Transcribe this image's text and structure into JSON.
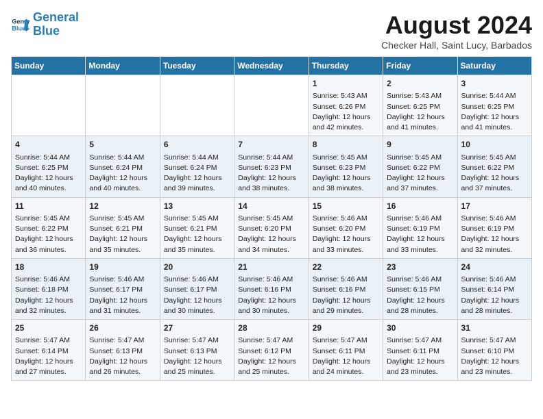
{
  "header": {
    "logo_line1": "General",
    "logo_line2": "Blue",
    "month_title": "August 2024",
    "subtitle": "Checker Hall, Saint Lucy, Barbados"
  },
  "days_of_week": [
    "Sunday",
    "Monday",
    "Tuesday",
    "Wednesday",
    "Thursday",
    "Friday",
    "Saturday"
  ],
  "weeks": [
    [
      {
        "day": "",
        "content": ""
      },
      {
        "day": "",
        "content": ""
      },
      {
        "day": "",
        "content": ""
      },
      {
        "day": "",
        "content": ""
      },
      {
        "day": "1",
        "content": "Sunrise: 5:43 AM\nSunset: 6:26 PM\nDaylight: 12 hours\nand 42 minutes."
      },
      {
        "day": "2",
        "content": "Sunrise: 5:43 AM\nSunset: 6:25 PM\nDaylight: 12 hours\nand 41 minutes."
      },
      {
        "day": "3",
        "content": "Sunrise: 5:44 AM\nSunset: 6:25 PM\nDaylight: 12 hours\nand 41 minutes."
      }
    ],
    [
      {
        "day": "4",
        "content": "Sunrise: 5:44 AM\nSunset: 6:25 PM\nDaylight: 12 hours\nand 40 minutes."
      },
      {
        "day": "5",
        "content": "Sunrise: 5:44 AM\nSunset: 6:24 PM\nDaylight: 12 hours\nand 40 minutes."
      },
      {
        "day": "6",
        "content": "Sunrise: 5:44 AM\nSunset: 6:24 PM\nDaylight: 12 hours\nand 39 minutes."
      },
      {
        "day": "7",
        "content": "Sunrise: 5:44 AM\nSunset: 6:23 PM\nDaylight: 12 hours\nand 38 minutes."
      },
      {
        "day": "8",
        "content": "Sunrise: 5:45 AM\nSunset: 6:23 PM\nDaylight: 12 hours\nand 38 minutes."
      },
      {
        "day": "9",
        "content": "Sunrise: 5:45 AM\nSunset: 6:22 PM\nDaylight: 12 hours\nand 37 minutes."
      },
      {
        "day": "10",
        "content": "Sunrise: 5:45 AM\nSunset: 6:22 PM\nDaylight: 12 hours\nand 37 minutes."
      }
    ],
    [
      {
        "day": "11",
        "content": "Sunrise: 5:45 AM\nSunset: 6:22 PM\nDaylight: 12 hours\nand 36 minutes."
      },
      {
        "day": "12",
        "content": "Sunrise: 5:45 AM\nSunset: 6:21 PM\nDaylight: 12 hours\nand 35 minutes."
      },
      {
        "day": "13",
        "content": "Sunrise: 5:45 AM\nSunset: 6:21 PM\nDaylight: 12 hours\nand 35 minutes."
      },
      {
        "day": "14",
        "content": "Sunrise: 5:45 AM\nSunset: 6:20 PM\nDaylight: 12 hours\nand 34 minutes."
      },
      {
        "day": "15",
        "content": "Sunrise: 5:46 AM\nSunset: 6:20 PM\nDaylight: 12 hours\nand 33 minutes."
      },
      {
        "day": "16",
        "content": "Sunrise: 5:46 AM\nSunset: 6:19 PM\nDaylight: 12 hours\nand 33 minutes."
      },
      {
        "day": "17",
        "content": "Sunrise: 5:46 AM\nSunset: 6:19 PM\nDaylight: 12 hours\nand 32 minutes."
      }
    ],
    [
      {
        "day": "18",
        "content": "Sunrise: 5:46 AM\nSunset: 6:18 PM\nDaylight: 12 hours\nand 32 minutes."
      },
      {
        "day": "19",
        "content": "Sunrise: 5:46 AM\nSunset: 6:17 PM\nDaylight: 12 hours\nand 31 minutes."
      },
      {
        "day": "20",
        "content": "Sunrise: 5:46 AM\nSunset: 6:17 PM\nDaylight: 12 hours\nand 30 minutes."
      },
      {
        "day": "21",
        "content": "Sunrise: 5:46 AM\nSunset: 6:16 PM\nDaylight: 12 hours\nand 30 minutes."
      },
      {
        "day": "22",
        "content": "Sunrise: 5:46 AM\nSunset: 6:16 PM\nDaylight: 12 hours\nand 29 minutes."
      },
      {
        "day": "23",
        "content": "Sunrise: 5:46 AM\nSunset: 6:15 PM\nDaylight: 12 hours\nand 28 minutes."
      },
      {
        "day": "24",
        "content": "Sunrise: 5:46 AM\nSunset: 6:14 PM\nDaylight: 12 hours\nand 28 minutes."
      }
    ],
    [
      {
        "day": "25",
        "content": "Sunrise: 5:47 AM\nSunset: 6:14 PM\nDaylight: 12 hours\nand 27 minutes."
      },
      {
        "day": "26",
        "content": "Sunrise: 5:47 AM\nSunset: 6:13 PM\nDaylight: 12 hours\nand 26 minutes."
      },
      {
        "day": "27",
        "content": "Sunrise: 5:47 AM\nSunset: 6:13 PM\nDaylight: 12 hours\nand 25 minutes."
      },
      {
        "day": "28",
        "content": "Sunrise: 5:47 AM\nSunset: 6:12 PM\nDaylight: 12 hours\nand 25 minutes."
      },
      {
        "day": "29",
        "content": "Sunrise: 5:47 AM\nSunset: 6:11 PM\nDaylight: 12 hours\nand 24 minutes."
      },
      {
        "day": "30",
        "content": "Sunrise: 5:47 AM\nSunset: 6:11 PM\nDaylight: 12 hours\nand 23 minutes."
      },
      {
        "day": "31",
        "content": "Sunrise: 5:47 AM\nSunset: 6:10 PM\nDaylight: 12 hours\nand 23 minutes."
      }
    ]
  ]
}
